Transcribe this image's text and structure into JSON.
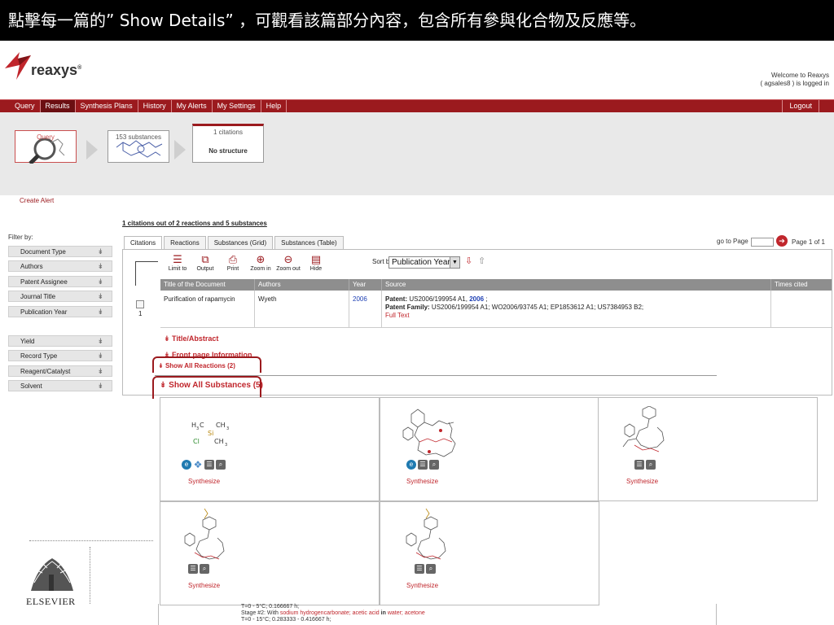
{
  "caption": "點擊每一篇的” Show Details” ，可觀看該篇部分內容，包含所有參與化合物及反應等。",
  "brand": {
    "name": "reaxys",
    "mark": "®"
  },
  "user": {
    "welcome": "Welcome to Reaxys",
    "status": "( agsales8 ) is logged in"
  },
  "nav": {
    "items": [
      "Query",
      "Results",
      "Synthesis Plans",
      "History",
      "My Alerts",
      "My Settings",
      "Help"
    ],
    "active": "Results",
    "logout": "Logout"
  },
  "workflow": {
    "query_label": "Query",
    "substances_label": "153 substances",
    "citations_label": "1 citations",
    "no_structure": "No structure",
    "create_alert": "Create Alert"
  },
  "results": {
    "summary": "1 citations out of 2 reactions and 5 substances",
    "filter_title": "Filter by:",
    "filters_group1": [
      "Document Type",
      "Authors",
      "Patent Assignee",
      "Journal Title",
      "Publication Year"
    ],
    "filters_group2": [
      "Yield",
      "Record Type",
      "Reagent/Catalyst",
      "Solvent"
    ],
    "tabs": [
      "Citations",
      "Reactions",
      "Substances (Grid)",
      "Substances (Table)"
    ],
    "active_tab": "Citations",
    "goto_label": "go to Page",
    "page_of": "Page 1 of 1"
  },
  "toolbar": {
    "buttons": [
      {
        "label": "Limit to",
        "icon": "limit-icon"
      },
      {
        "label": "Output",
        "icon": "output-icon"
      },
      {
        "label": "Print",
        "icon": "print-icon"
      },
      {
        "label": "Zoom in",
        "icon": "zoom-in-icon"
      },
      {
        "label": "Zoom out",
        "icon": "zoom-out-icon"
      },
      {
        "label": "Hide",
        "icon": "hide-icon"
      }
    ],
    "sort_label": "Sort by",
    "sort_value": "Publication Year"
  },
  "table": {
    "headers": [
      "Title of the Document",
      "Authors",
      "Year",
      "Source",
      "Times cited"
    ],
    "row": {
      "number": "1",
      "title": "Purification of rapamycin",
      "authors": "Wyeth",
      "year": "2006",
      "patent_label": "Patent:",
      "patent_value": "US2006/199954 A1,",
      "patent_year": "2006",
      "patent_tail": ";",
      "family_label": "Patent Family:",
      "family_value": "US2006/199954 A1; WO2006/93745 A1; EP1853612 A1; US7384953 B2;",
      "full_text": "Full Text",
      "times_cited": ""
    }
  },
  "details": {
    "title_abstract": "Title/Abstract",
    "front_page": "Front page Information",
    "show_reactions": "Show All Reactions (2)",
    "show_substances": "Show All Substances (5)"
  },
  "substances": {
    "synthesize": "Synthesize",
    "cells": 5
  },
  "bottom": {
    "publisher": "ELSEVIER",
    "stage_line1": "T=0 - 5°C; 0.166667 h;",
    "stage_line2_pre": "Stage #2: With",
    "stage_line2_reagents": "sodium hydrogencarbonate; acetic acid",
    "stage_line2_in": "in",
    "stage_line2_solvents": "water; acetone",
    "stage_line3": "T=0 - 15°C; 0.283333 - 0.416667 h;"
  },
  "colors": {
    "brand": "#9b1a1e",
    "link": "#c0262c",
    "accent_blue": "#1d3fb3"
  }
}
